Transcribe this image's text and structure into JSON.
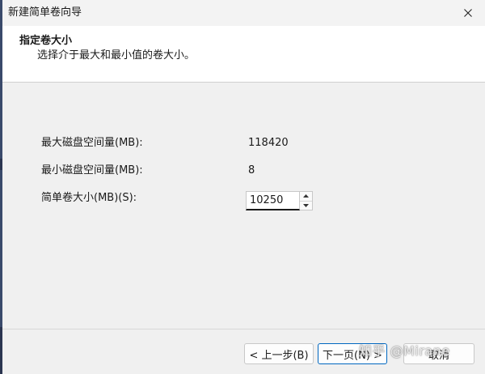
{
  "window": {
    "title": "新建简单卷向导"
  },
  "header": {
    "title": "指定卷大小",
    "subtitle": "选择介于最大和最小值的卷大小。"
  },
  "form": {
    "max_label": "最大磁盘空间量(MB):",
    "max_value": "118420",
    "min_label": "最小磁盘空间量(MB):",
    "min_value": "8",
    "size_label": "简单卷大小(MB)(S):",
    "size_value": "10250"
  },
  "buttons": {
    "back": "< 上一步(B)",
    "next": "下一页(N) >",
    "cancel": "取消"
  },
  "watermark": "知乎 @Mirane",
  "icons": {
    "close": "close-icon",
    "spin_up": "chevron-up-icon",
    "spin_down": "chevron-down-icon"
  },
  "colors": {
    "accent": "#0067c0",
    "background": "#f0f0f0",
    "header_background": "#ffffff"
  }
}
